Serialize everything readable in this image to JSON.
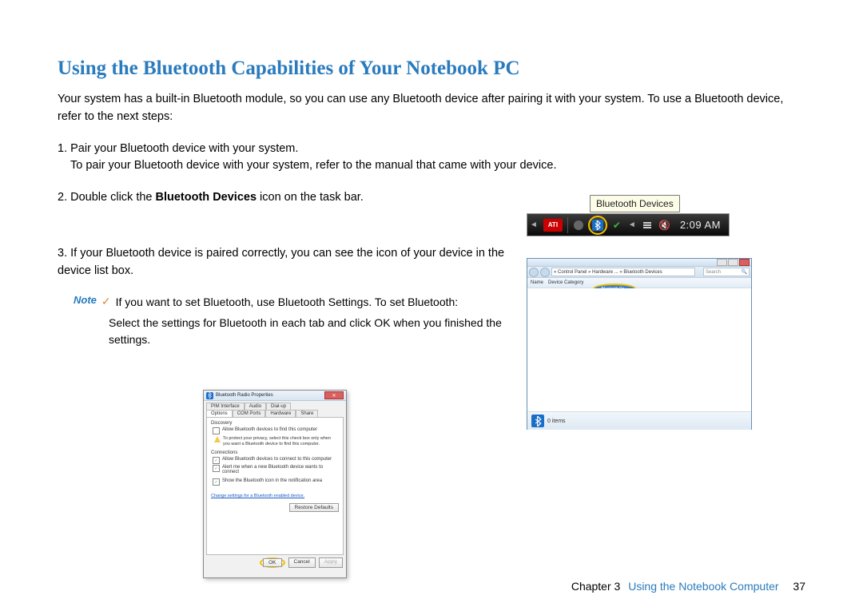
{
  "heading": "Using the Bluetooth Capabilities of Your Notebook PC",
  "intro": "Your system has a built-in Bluetooth module, so you can use any Bluetooth device after pairing it with your system. To use a Bluetooth device, refer to the next steps:",
  "step1": {
    "lead": "1. Pair your Bluetooth device with your system.",
    "sub": "To pair your Bluetooth device with your system, refer to the manual that came with your device."
  },
  "step2": {
    "lead_a": "2. Double click the ",
    "bold": "Bluetooth Devices",
    "lead_b": " icon on the task bar."
  },
  "step3": {
    "lead": "3. If your Bluetooth device is paired correctly, you can see the icon of your device in the device list box."
  },
  "note": {
    "label": "Note",
    "check": "✓",
    "text": "If you want to set Bluetooth, use Bluetooth Settings. To set Bluetooth:",
    "sub": "Select the settings for Bluetooth in each tab and click OK when you finished the settings."
  },
  "tooltip": "Bluetooth Devices",
  "taskbar": {
    "ati": "ATI",
    "clock": "2:09 AM"
  },
  "explorer": {
    "path": "« Control Panel » Hardware ... » Bluetooth Devices",
    "search_placeholder": "Search",
    "toolbar_name": "Name",
    "toolbar_cat": "Device Category",
    "selected": "Bluetooth De...",
    "item_label": "0 items"
  },
  "props": {
    "title": "Bluetooth Radio Properties",
    "tabs_row1": [
      "PIM Interface",
      "Audio",
      "Dial-up"
    ],
    "tabs_row2": [
      "Options",
      "COM Ports",
      "Hardware",
      "Share"
    ],
    "active_tab": "Options",
    "discovery": {
      "title": "Discovery",
      "cb1": "Allow Bluetooth devices to find this computer",
      "warn": "To protect your privacy, select this check box only when you want a Bluetooth device to find this computer."
    },
    "connections": {
      "title": "Connections",
      "cb1": "Allow Bluetooth devices to connect to this computer",
      "cb2": "Alert me when a new Bluetooth device wants to connect"
    },
    "show_icon": "Show the Bluetooth icon in the notification area",
    "link": "Change settings for a Bluetooth enabled device.",
    "restore": "Restore Defaults",
    "ok": "OK",
    "cancel": "Cancel",
    "apply": "Apply"
  },
  "footer": {
    "chapter": "Chapter 3",
    "title": "Using the Notebook Computer",
    "page": "37"
  }
}
